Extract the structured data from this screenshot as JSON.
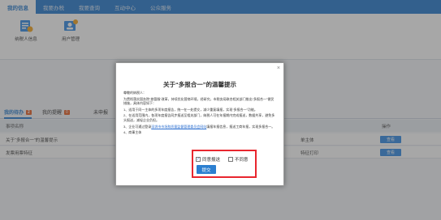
{
  "nav": {
    "items": [
      "我的信息",
      "我要办税",
      "我要查询",
      "互动中心",
      "公众服务"
    ]
  },
  "shortcuts": [
    {
      "label": "纳税人信息",
      "icon": "taxpayer-info-icon"
    },
    {
      "label": "用户管理",
      "icon": "user-management-icon"
    }
  ],
  "tabs": [
    {
      "label": "我的待办",
      "badge": "2"
    },
    {
      "label": "我的提醒",
      "badge": "0"
    },
    {
      "label": "未申报"
    }
  ],
  "table": {
    "headers": [
      "事项名称",
      "操作"
    ],
    "rows": [
      {
        "name": "关于“多报合一”的温馨提示",
        "extra": "单主体",
        "action": "查看"
      },
      {
        "name": "发票用票特征",
        "extra": "特征打印",
        "action": "查看"
      }
    ]
  },
  "modal": {
    "title": "关于“多报合一”的温馨提示",
    "close": "×",
    "body": [
      "尊敬的纳税人：",
      "为贯彻落实国务院“放管服”改革，持续优化营商环境，经研究，市税务局联合相关部门推出“多报合一”便民措施，具体内容如下：",
      "1、适用于同一主体的多项年度报告，统一在一处提交，减少重复填报，实现“多报合一”功能。",
      "2、在适用范围内，各项年度报告同步报送至相关部门，纳税人可在年报期内完成报送，数据共享，避免多头报送，减轻企业负担。",
      "3、企业可通过登录",
      "4、商事主体"
    ],
    "link_text": "深圳市市场和质量监督管理委员会网站",
    "link_tail": "填报年报信息，报送工商年报，实现多报合一。",
    "options": {
      "agree": "同意报送",
      "disagree": "不同意"
    },
    "agree_mark": "✓",
    "submit": "提交"
  },
  "colors": {
    "nav": "#2c7fd0",
    "primary_button": "#2c7fd0",
    "badge": "#e8632b",
    "highlight": "#e8262e"
  }
}
